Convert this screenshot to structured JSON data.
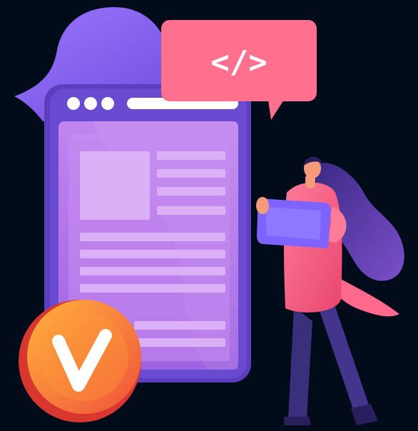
{
  "illustration": {
    "code_bubble_text": "</>",
    "colors": {
      "background": "#020b1a",
      "blob": "#8a63ee",
      "browser_frame": "#5a3fc0",
      "browser_page": "#b77ae6",
      "code_bubble": "#ff6f8e",
      "coin": "#f7742f",
      "person_top": "#f56b8c",
      "person_hair": "#3d2b8a",
      "tablet": "#7e63ff"
    },
    "icons": [
      "check-icon",
      "code-icon",
      "browser-dots-icon"
    ]
  }
}
